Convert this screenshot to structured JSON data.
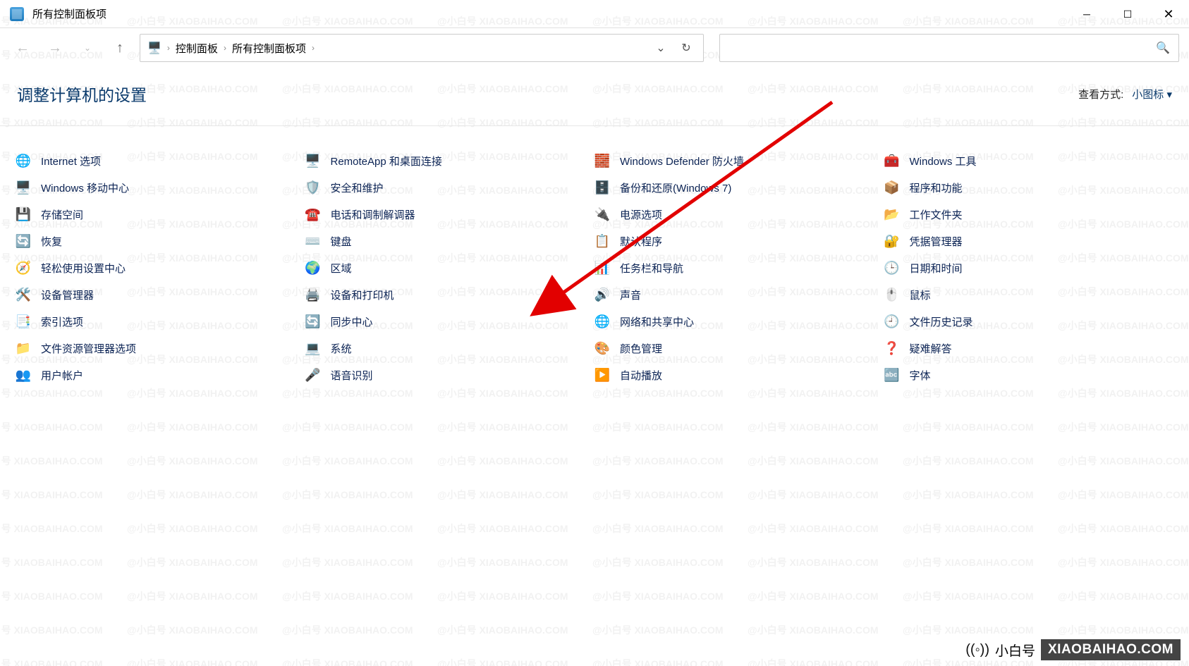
{
  "window": {
    "title": "所有控制面板项"
  },
  "breadcrumb": {
    "root": "控制面板",
    "current": "所有控制面板项"
  },
  "search": {
    "placeholder": ""
  },
  "header": {
    "title": "调整计算机的设置",
    "view_label": "查看方式:",
    "view_value": "小图标"
  },
  "columns": [
    [
      {
        "icon": "🌐",
        "label": "Internet 选项",
        "name": "internet-options"
      },
      {
        "icon": "🖥️",
        "label": "Windows 移动中心",
        "name": "mobility-center"
      },
      {
        "icon": "💾",
        "label": "存储空间",
        "name": "storage-spaces"
      },
      {
        "icon": "🔄",
        "label": "恢复",
        "name": "recovery"
      },
      {
        "icon": "🧭",
        "label": "轻松使用设置中心",
        "name": "ease-of-access"
      },
      {
        "icon": "🛠️",
        "label": "设备管理器",
        "name": "device-manager"
      },
      {
        "icon": "📑",
        "label": "索引选项",
        "name": "indexing-options"
      },
      {
        "icon": "📁",
        "label": "文件资源管理器选项",
        "name": "explorer-options"
      },
      {
        "icon": "👥",
        "label": "用户帐户",
        "name": "user-accounts"
      }
    ],
    [
      {
        "icon": "🖥️",
        "label": "RemoteApp 和桌面连接",
        "name": "remoteapp"
      },
      {
        "icon": "🛡️",
        "label": "安全和维护",
        "name": "security-maintenance"
      },
      {
        "icon": "☎️",
        "label": "电话和调制解调器",
        "name": "phone-modem"
      },
      {
        "icon": "⌨️",
        "label": "键盘",
        "name": "keyboard"
      },
      {
        "icon": "🌍",
        "label": "区域",
        "name": "region"
      },
      {
        "icon": "🖨️",
        "label": "设备和打印机",
        "name": "devices-printers"
      },
      {
        "icon": "🔄",
        "label": "同步中心",
        "name": "sync-center"
      },
      {
        "icon": "💻",
        "label": "系统",
        "name": "system"
      },
      {
        "icon": "🎤",
        "label": "语音识别",
        "name": "speech-recognition"
      }
    ],
    [
      {
        "icon": "🧱",
        "label": "Windows Defender 防火墙",
        "name": "defender-firewall"
      },
      {
        "icon": "🗄️",
        "label": "备份和还原(Windows 7)",
        "name": "backup-restore"
      },
      {
        "icon": "🔌",
        "label": "电源选项",
        "name": "power-options"
      },
      {
        "icon": "📋",
        "label": "默认程序",
        "name": "default-programs"
      },
      {
        "icon": "📊",
        "label": "任务栏和导航",
        "name": "taskbar-navigation"
      },
      {
        "icon": "🔊",
        "label": "声音",
        "name": "sound"
      },
      {
        "icon": "🌐",
        "label": "网络和共享中心",
        "name": "network-sharing"
      },
      {
        "icon": "🎨",
        "label": "颜色管理",
        "name": "color-management"
      },
      {
        "icon": "▶️",
        "label": "自动播放",
        "name": "autoplay"
      }
    ],
    [
      {
        "icon": "🧰",
        "label": "Windows 工具",
        "name": "windows-tools"
      },
      {
        "icon": "📦",
        "label": "程序和功能",
        "name": "programs-features"
      },
      {
        "icon": "📂",
        "label": "工作文件夹",
        "name": "work-folders"
      },
      {
        "icon": "🔐",
        "label": "凭据管理器",
        "name": "credential-manager"
      },
      {
        "icon": "🕒",
        "label": "日期和时间",
        "name": "date-time"
      },
      {
        "icon": "🖱️",
        "label": "鼠标",
        "name": "mouse"
      },
      {
        "icon": "🕘",
        "label": "文件历史记录",
        "name": "file-history"
      },
      {
        "icon": "❓",
        "label": "疑难解答",
        "name": "troubleshooting"
      },
      {
        "icon": "🔤",
        "label": "字体",
        "name": "fonts"
      }
    ]
  ],
  "watermark_text": "@小白号  XIAOBAIHAO.COM",
  "footer": {
    "brand": "小白号",
    "url": "XIAOBAIHAO.COM"
  },
  "arrow": {
    "target_item": "network-sharing"
  }
}
